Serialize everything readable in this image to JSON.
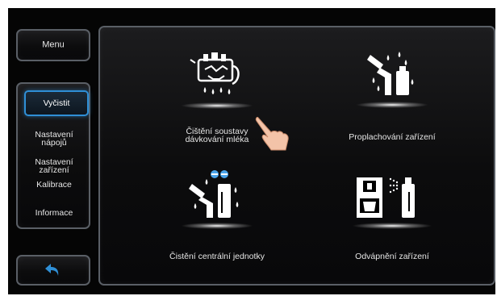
{
  "sidebar": {
    "menu_label": "Menu",
    "items": [
      {
        "label": "Vyčistit",
        "active": true
      },
      {
        "label": "Nastavení\nnápojů"
      },
      {
        "label": "Nastavení\nzařízení"
      },
      {
        "label": "Kalibrace"
      },
      {
        "label": "Informace"
      }
    ],
    "back_icon": "back-arrow-icon"
  },
  "tiles": [
    {
      "label": "Čištění soustavy\ndávkování mléka",
      "icon": "milk-system-cleaning-icon"
    },
    {
      "label": "Proplachování zařízení",
      "icon": "rinse-device-icon"
    },
    {
      "label": "Čistění centrální jednotky",
      "icon": "central-unit-cleaning-icon"
    },
    {
      "label": "Odvápnění zařízení",
      "icon": "descaling-icon"
    }
  ],
  "colors": {
    "accent": "#2f8fd6",
    "panel_border": "#5a5f66",
    "background": "#050505"
  }
}
